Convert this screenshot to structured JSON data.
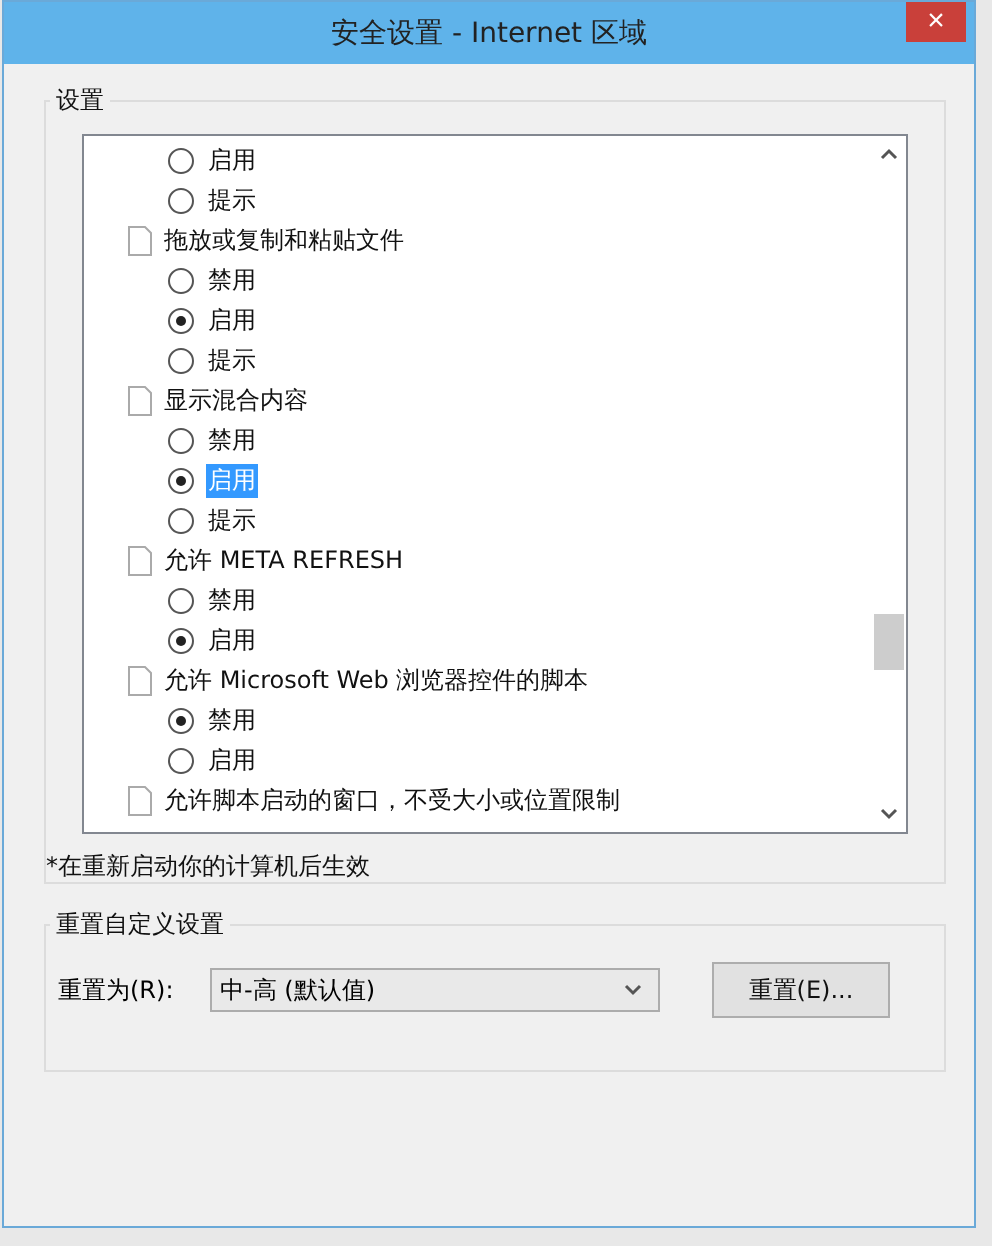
{
  "window": {
    "title": "安全设置 - Internet 区域",
    "close": "×"
  },
  "settings": {
    "label": "设置",
    "items": [
      {
        "kind": "option",
        "label": "启用",
        "selected": false,
        "focused": false
      },
      {
        "kind": "option",
        "label": "提示",
        "selected": false,
        "focused": false
      },
      {
        "kind": "heading",
        "label": "拖放或复制和粘贴文件"
      },
      {
        "kind": "option",
        "label": "禁用",
        "selected": false,
        "focused": false
      },
      {
        "kind": "option",
        "label": "启用",
        "selected": true,
        "focused": false
      },
      {
        "kind": "option",
        "label": "提示",
        "selected": false,
        "focused": false
      },
      {
        "kind": "heading",
        "label": "显示混合内容"
      },
      {
        "kind": "option",
        "label": "禁用",
        "selected": false,
        "focused": false
      },
      {
        "kind": "option",
        "label": "启用",
        "selected": true,
        "focused": true
      },
      {
        "kind": "option",
        "label": "提示",
        "selected": false,
        "focused": false
      },
      {
        "kind": "heading",
        "label": "允许 META REFRESH"
      },
      {
        "kind": "option",
        "label": "禁用",
        "selected": false,
        "focused": false
      },
      {
        "kind": "option",
        "label": "启用",
        "selected": true,
        "focused": false
      },
      {
        "kind": "heading",
        "label": "允许 Microsoft Web 浏览器控件的脚本"
      },
      {
        "kind": "option",
        "label": "禁用",
        "selected": true,
        "focused": false
      },
      {
        "kind": "option",
        "label": "启用",
        "selected": false,
        "focused": false
      },
      {
        "kind": "heading",
        "label": "允许脚本启动的窗口，不受大小或位置限制"
      }
    ],
    "note": "*在重新启动你的计算机后生效"
  },
  "reset": {
    "label": "重置自定义设置",
    "field_label": "重置为(R):",
    "value": "中-高 (默认值)",
    "button": "重置(E)..."
  }
}
